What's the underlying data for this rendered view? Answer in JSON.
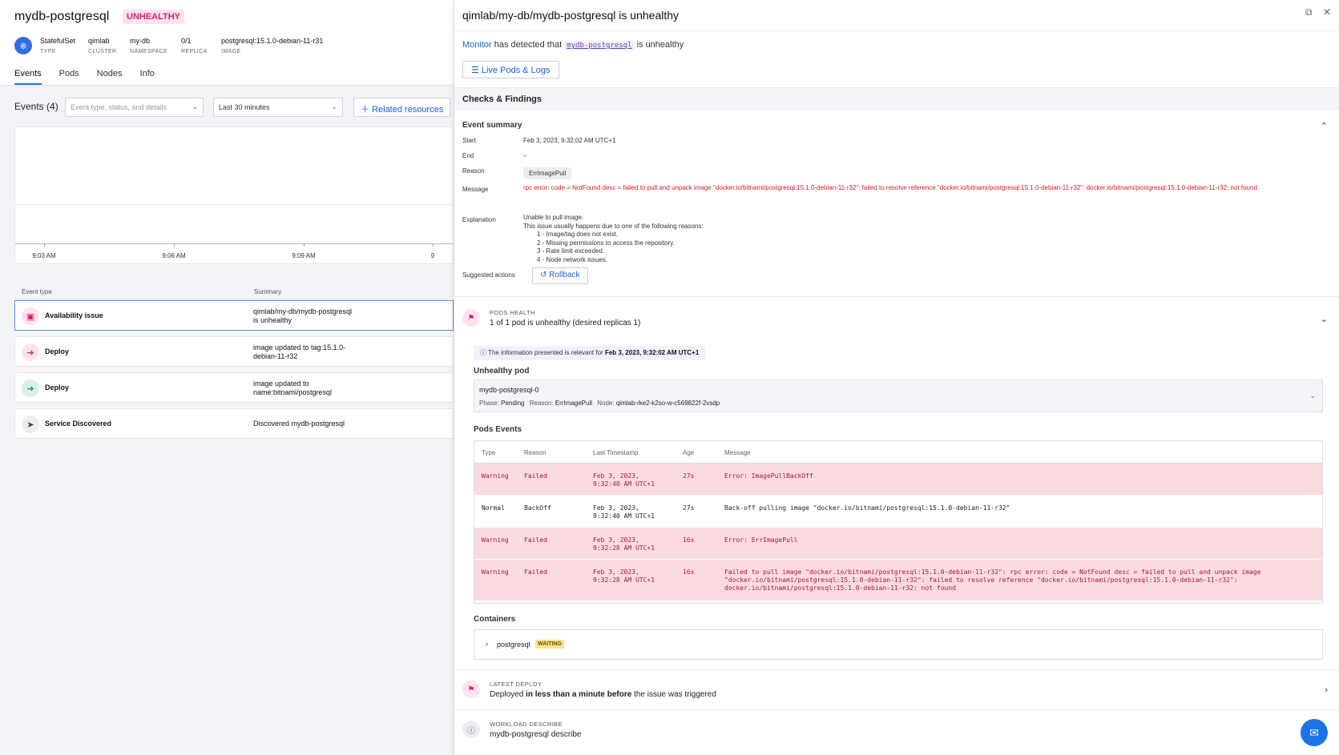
{
  "service": {
    "name": "mydb-postgresql",
    "status": "UNHEALTHY",
    "meta": [
      {
        "value": "StatefulSet",
        "label": "TYPE"
      },
      {
        "value": "qimlab",
        "label": "CLUSTER"
      },
      {
        "value": "my-db",
        "label": "NAMESPACE"
      },
      {
        "value": "0/1",
        "label": "REPLICA"
      },
      {
        "value": "postgresql:15.1.0-debian-11-r31",
        "label": "IMAGE"
      }
    ],
    "tabs": [
      "Events",
      "Pods",
      "Nodes",
      "Info"
    ]
  },
  "events": {
    "count_label": "Events (4)",
    "filter_placeholder": "Event type, status, and details",
    "time_range": "Last 30 minutes",
    "related_label": "Related resources",
    "ticks": [
      "9:03 AM",
      "9:06 AM",
      "9:09 AM",
      "9"
    ],
    "col_type": "Event type",
    "col_summary": "Summary",
    "rows": [
      {
        "type": "Availability issue",
        "summary": "qimlab/my-db/mydb-postgresql is unhealthy"
      },
      {
        "type": "Deploy",
        "summary": "image updated to tag:15.1.0-debian-11-r32"
      },
      {
        "type": "Deploy",
        "summary": "image updated to name:bitnami/postgresql"
      },
      {
        "type": "Service Discovered",
        "summary": "Discovered mydb-postgresql"
      }
    ]
  },
  "drawer": {
    "title": "qimlab/my-db/mydb-postgresql is unhealthy",
    "detected_prefix": "Monitor",
    "detected_mid": "has detected that",
    "detected_code": "mydb-postgresql",
    "detected_suffix": "is unhealthy",
    "live_label": "Live Pods & Logs",
    "checks_label": "Checks & Findings",
    "summary": {
      "title": "Event summary",
      "start_label": "Start",
      "start": "Feb 3, 2023, 9:32:02 AM UTC+1",
      "end_label": "End",
      "end": "–",
      "reason_label": "Reason",
      "reason": "ErrImagePull",
      "message_label": "Message",
      "message": "rpc error: code = NotFound desc = failed to pull and unpack image \"docker.io/bitnami/postgresql:15.1.0-debian-11-r32\": failed to resolve reference \"docker.io/bitnami/postgresql:15.1.0-debian-11-r32\": docker.io/bitnami/postgresql:15.1.0-debian-11-r32: not found",
      "explanation_label": "Explanation",
      "explanation": [
        "Unable to pull image.",
        "This issue usually happens due to one of the following reasons:"
      ],
      "reasons": [
        "1 - Image/tag does not exist.",
        "2 - Missing permissions to access the repository.",
        "3 - Rate limit exceeded.",
        "4 - Node network issues."
      ],
      "actions_label": "Suggested actions",
      "rollback_label": "Rollback"
    },
    "pods_health": {
      "label": "PODS HEALTH",
      "value": "1 of 1 pod is unhealthy (desired replicas 1)",
      "info_prefix": "The information presented is relevant for",
      "info_time": "Feb 3, 2023, 9:32:02 AM UTC+1",
      "unhealthy_title": "Unhealthy pod",
      "pod_name": "mydb-postgresql-0",
      "phase_label": "Phase:",
      "phase": "Pending",
      "reason_label": "Reason:",
      "reason": "ErrImagePull",
      "node_label": "Node:",
      "node": "qimlab-rke2-k2so-w-c569822f-2vsdp",
      "events_title": "Pods Events",
      "cols": [
        "Type",
        "Reason",
        "Last Timestamp",
        "Age",
        "Message"
      ],
      "rows": [
        {
          "type": "Warning",
          "reason": "Failed",
          "ts": "Feb 3, 2023, 9:32:40 AM UTC+1",
          "age": "27s",
          "message": "Error: ImagePullBackOff"
        },
        {
          "type": "Normal",
          "reason": "BackOff",
          "ts": "Feb 3, 2023, 9:32:40 AM UTC+1",
          "age": "27s",
          "message": "Back-off pulling image \"docker.io/bitnami/postgresql:15.1.0-debian-11-r32\""
        },
        {
          "type": "Warning",
          "reason": "Failed",
          "ts": "Feb 3, 2023, 9:32:28 AM UTC+1",
          "age": "16s",
          "message": "Error: ErrImagePull"
        },
        {
          "type": "Warning",
          "reason": "Failed",
          "ts": "Feb 3, 2023, 9:32:28 AM UTC+1",
          "age": "16s",
          "message": "Failed to pull image \"docker.io/bitnami/postgresql:15.1.0-debian-11-r32\": rpc error: code = NotFound desc = failed to pull and unpack image \"docker.io/bitnami/postgresql:15.1.0-debian-11-r32\": failed to resolve reference \"docker.io/bitnami/postgresql:15.1.0-debian-11-r32\": docker.io/bitnami/postgresql:15.1.0-debian-11-r32: not found"
        }
      ],
      "containers_title": "Containers",
      "container_name": "postgresql",
      "container_status": "WAITING"
    },
    "latest_deploy": {
      "label": "LATEST DEPLOY",
      "prefix": "Deployed",
      "bold": "in less than a minute before",
      "suffix": "the issue was triggered"
    },
    "workload": {
      "label": "WORKLOAD DESCRIBE",
      "value": "mydb-postgresql describe"
    }
  },
  "colors": {
    "accent": "#1a73e8",
    "unhealthy": "#d8206e",
    "warning_row": "#fadbe0",
    "error_text": "#d11a2a"
  }
}
